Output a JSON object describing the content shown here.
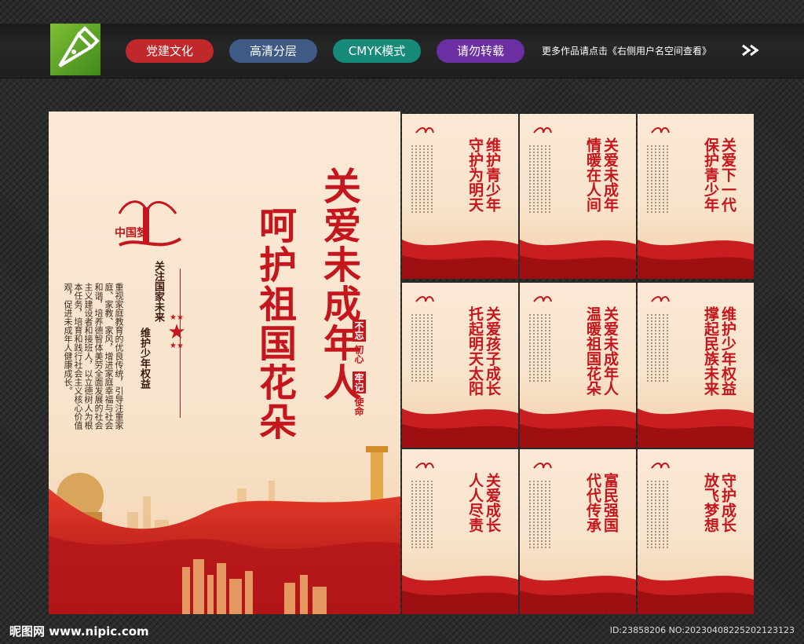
{
  "header": {
    "tags": [
      {
        "label": "党建文化",
        "color": "#c0282b"
      },
      {
        "label": "高清分层",
        "color": "#3f5a84"
      },
      {
        "label": "CMYK模式",
        "color": "#178a7a"
      },
      {
        "label": "请勿转载",
        "color": "#6c2fa3"
      }
    ],
    "more_text": "更多作品请点击《右侧用户名空间查看》",
    "logo_icon": "pen-nib-icon"
  },
  "main_board": {
    "title_line_1": "关爱未成年人",
    "title_line_2": "呵护祖国花朵",
    "emblem_text": "中国梦",
    "subtitle_1": "关注国家未来",
    "subtitle_2": "维护少年权益",
    "body": "重视家庭教育的优良传统，引导注重家庭、家教、家风，增进家庭幸福与社会和谐，培养德智体美劳全面发展的社会主义建设者和接班人，以立德树人为根本任务，培育和践行社会主义核心价值观，促进未成年人健康成长。",
    "motto_1": "不忘",
    "motto_2": "初心",
    "motto_3": "牢记",
    "motto_4": "使命",
    "accent_color": "#c4161c"
  },
  "small_boards": [
    {
      "title": "维护青少年\n守护为明天"
    },
    {
      "title": "关爱未成年\n情暖在人间"
    },
    {
      "title": "关爱下一代\n保护青少年"
    },
    {
      "title": "关爱孩子成长\n托起明天太阳"
    },
    {
      "title": "关爱未成年人\n温暖祖国花朵"
    },
    {
      "title": "维护少年权益\n撑起民族未来"
    },
    {
      "title": "关爱成长\n人人尽责"
    },
    {
      "title": "富民强国\n代代传承"
    },
    {
      "title": "守护成长\n放飞梦想"
    }
  ],
  "footer": {
    "site": "昵图网 www.nipic.com",
    "id_text": "ID:23858206 NO:20230408225202123123"
  }
}
